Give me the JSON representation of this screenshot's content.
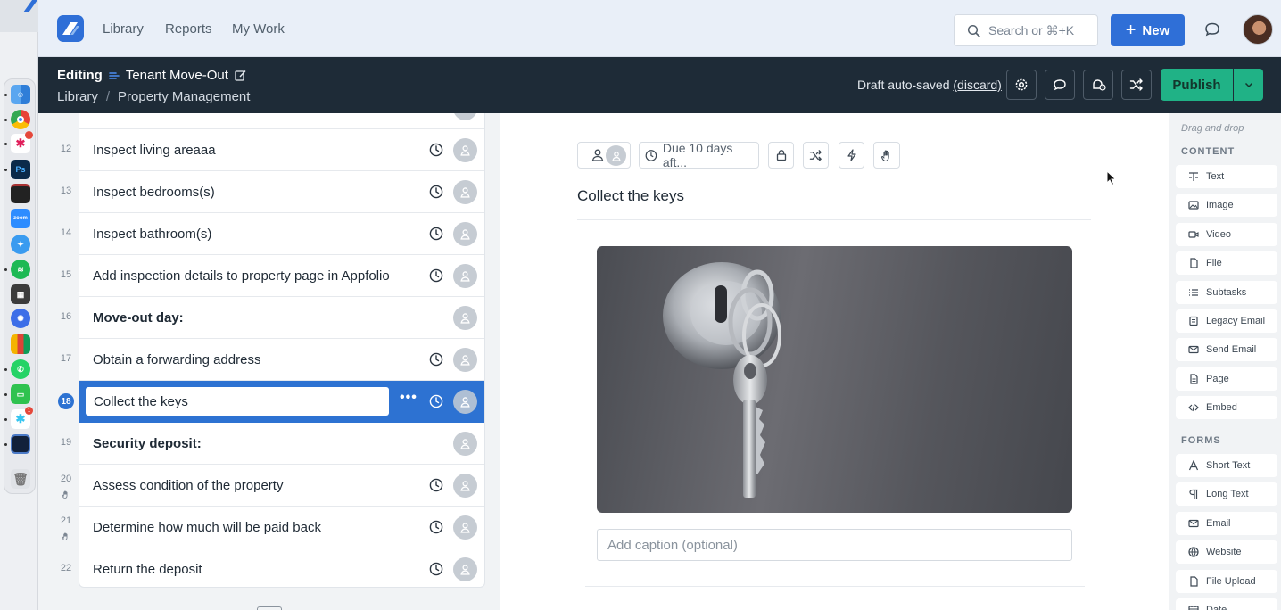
{
  "nav": {
    "links": [
      "Library",
      "Reports",
      "My Work"
    ],
    "search_placeholder": "Search or ⌘+K",
    "new_label": "New"
  },
  "header": {
    "editing_label": "Editing",
    "workflow_name": "Tenant Move-Out",
    "breadcrumb": [
      "Library",
      "/",
      "Property Management"
    ],
    "draft_text": "Draft auto-saved",
    "discard_label": "(discard)",
    "publish_label": "Publish"
  },
  "tasks": [
    {
      "num": "12",
      "label": "Inspect living areaaa",
      "bold": false,
      "clock": true
    },
    {
      "num": "13",
      "label": "Inspect bedrooms(s)",
      "bold": false,
      "clock": true
    },
    {
      "num": "14",
      "label": "Inspect bathroom(s)",
      "bold": false,
      "clock": true
    },
    {
      "num": "15",
      "label": "Add inspection details to property page in Appfolio",
      "bold": false,
      "clock": true
    },
    {
      "num": "16",
      "label": "Move-out day:",
      "bold": true,
      "clock": false
    },
    {
      "num": "17",
      "label": "Obtain a forwarding address",
      "bold": false,
      "clock": true
    },
    {
      "num": "18",
      "label": "Collect the keys",
      "bold": false,
      "clock": true,
      "selected": true
    },
    {
      "num": "19",
      "label": "Security deposit:",
      "bold": true,
      "clock": false
    },
    {
      "num": "20",
      "label": "Assess condition of the property",
      "bold": false,
      "clock": true,
      "stop": true
    },
    {
      "num": "21",
      "label": "Determine how much will be paid back",
      "bold": false,
      "clock": true,
      "stop": true
    },
    {
      "num": "22",
      "label": "Return the deposit",
      "bold": false,
      "clock": true
    }
  ],
  "editor": {
    "due_label": "Due 10 days aft...",
    "task_title": "Collect the keys",
    "caption_placeholder": "Add caption (optional)"
  },
  "widgets": {
    "drag_hint": "Drag and drop",
    "content_heading": "CONTENT",
    "content": [
      {
        "label": "Text",
        "icon": "text-icon"
      },
      {
        "label": "Image",
        "icon": "image-icon"
      },
      {
        "label": "Video",
        "icon": "video-icon"
      },
      {
        "label": "File",
        "icon": "file-icon"
      },
      {
        "label": "Subtasks",
        "icon": "list-icon"
      },
      {
        "label": "Legacy Email",
        "icon": "legacy-email-icon"
      },
      {
        "label": "Send Email",
        "icon": "mail-icon"
      },
      {
        "label": "Page",
        "icon": "page-icon"
      },
      {
        "label": "Embed",
        "icon": "code-icon"
      }
    ],
    "forms_heading": "FORMS",
    "forms": [
      {
        "label": "Short Text",
        "icon": "short-text-icon"
      },
      {
        "label": "Long Text",
        "icon": "paragraph-icon"
      },
      {
        "label": "Email",
        "icon": "mail-icon"
      },
      {
        "label": "Website",
        "icon": "globe-icon"
      },
      {
        "label": "File Upload",
        "icon": "file-icon"
      },
      {
        "label": "Date",
        "icon": "calendar-icon"
      }
    ]
  },
  "dock": {
    "badges": [
      "",
      "1"
    ]
  },
  "colors": {
    "primary": "#2f6fd7",
    "header_bg": "#1e2b37",
    "publish": "#20b286",
    "selected_row": "#2d72d2"
  }
}
